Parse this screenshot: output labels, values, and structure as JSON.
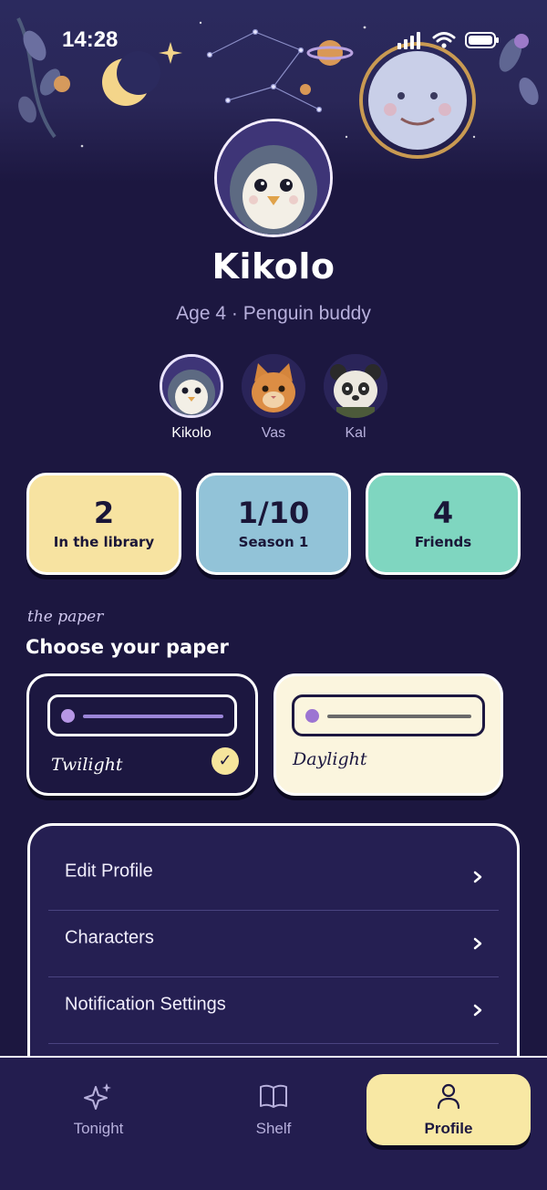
{
  "status_bar": {
    "time": "14:28"
  },
  "profile": {
    "name": "Kikolo",
    "subtitle": "Age 4 · Penguin buddy"
  },
  "buddies": [
    {
      "name": "Kikolo",
      "icon": "penguin-avatar",
      "active": true
    },
    {
      "name": "Vas",
      "icon": "cat-avatar",
      "active": false
    },
    {
      "name": "Kal",
      "icon": "panda-avatar",
      "active": false
    }
  ],
  "stats": [
    {
      "value": "2",
      "label": "In the library",
      "color": "#f7e3a1"
    },
    {
      "value": "1/10",
      "label": "Season 1",
      "color": "#92c3d8"
    },
    {
      "value": "4",
      "label": "Friends",
      "color": "#7fd6c0"
    }
  ],
  "paper": {
    "kicker": "the paper",
    "title": "Choose your paper",
    "options": [
      {
        "label": "Twilight",
        "selected": true,
        "bg": "#1c1740"
      },
      {
        "label": "Daylight",
        "selected": false,
        "bg": "#fbf5de"
      }
    ]
  },
  "settings": {
    "items": [
      {
        "label": "Edit Profile"
      },
      {
        "label": "Characters"
      },
      {
        "label": "Notification Settings"
      }
    ]
  },
  "tabs": [
    {
      "label": "Tonight",
      "icon": "sparkles-icon",
      "active": false
    },
    {
      "label": "Shelf",
      "icon": "book-icon",
      "active": false
    },
    {
      "label": "Profile",
      "icon": "person-icon",
      "active": true
    }
  ],
  "colors": {
    "background": "#1c1740",
    "accent_yellow": "#f8e8a4",
    "muted_text": "#b7b0dc"
  }
}
